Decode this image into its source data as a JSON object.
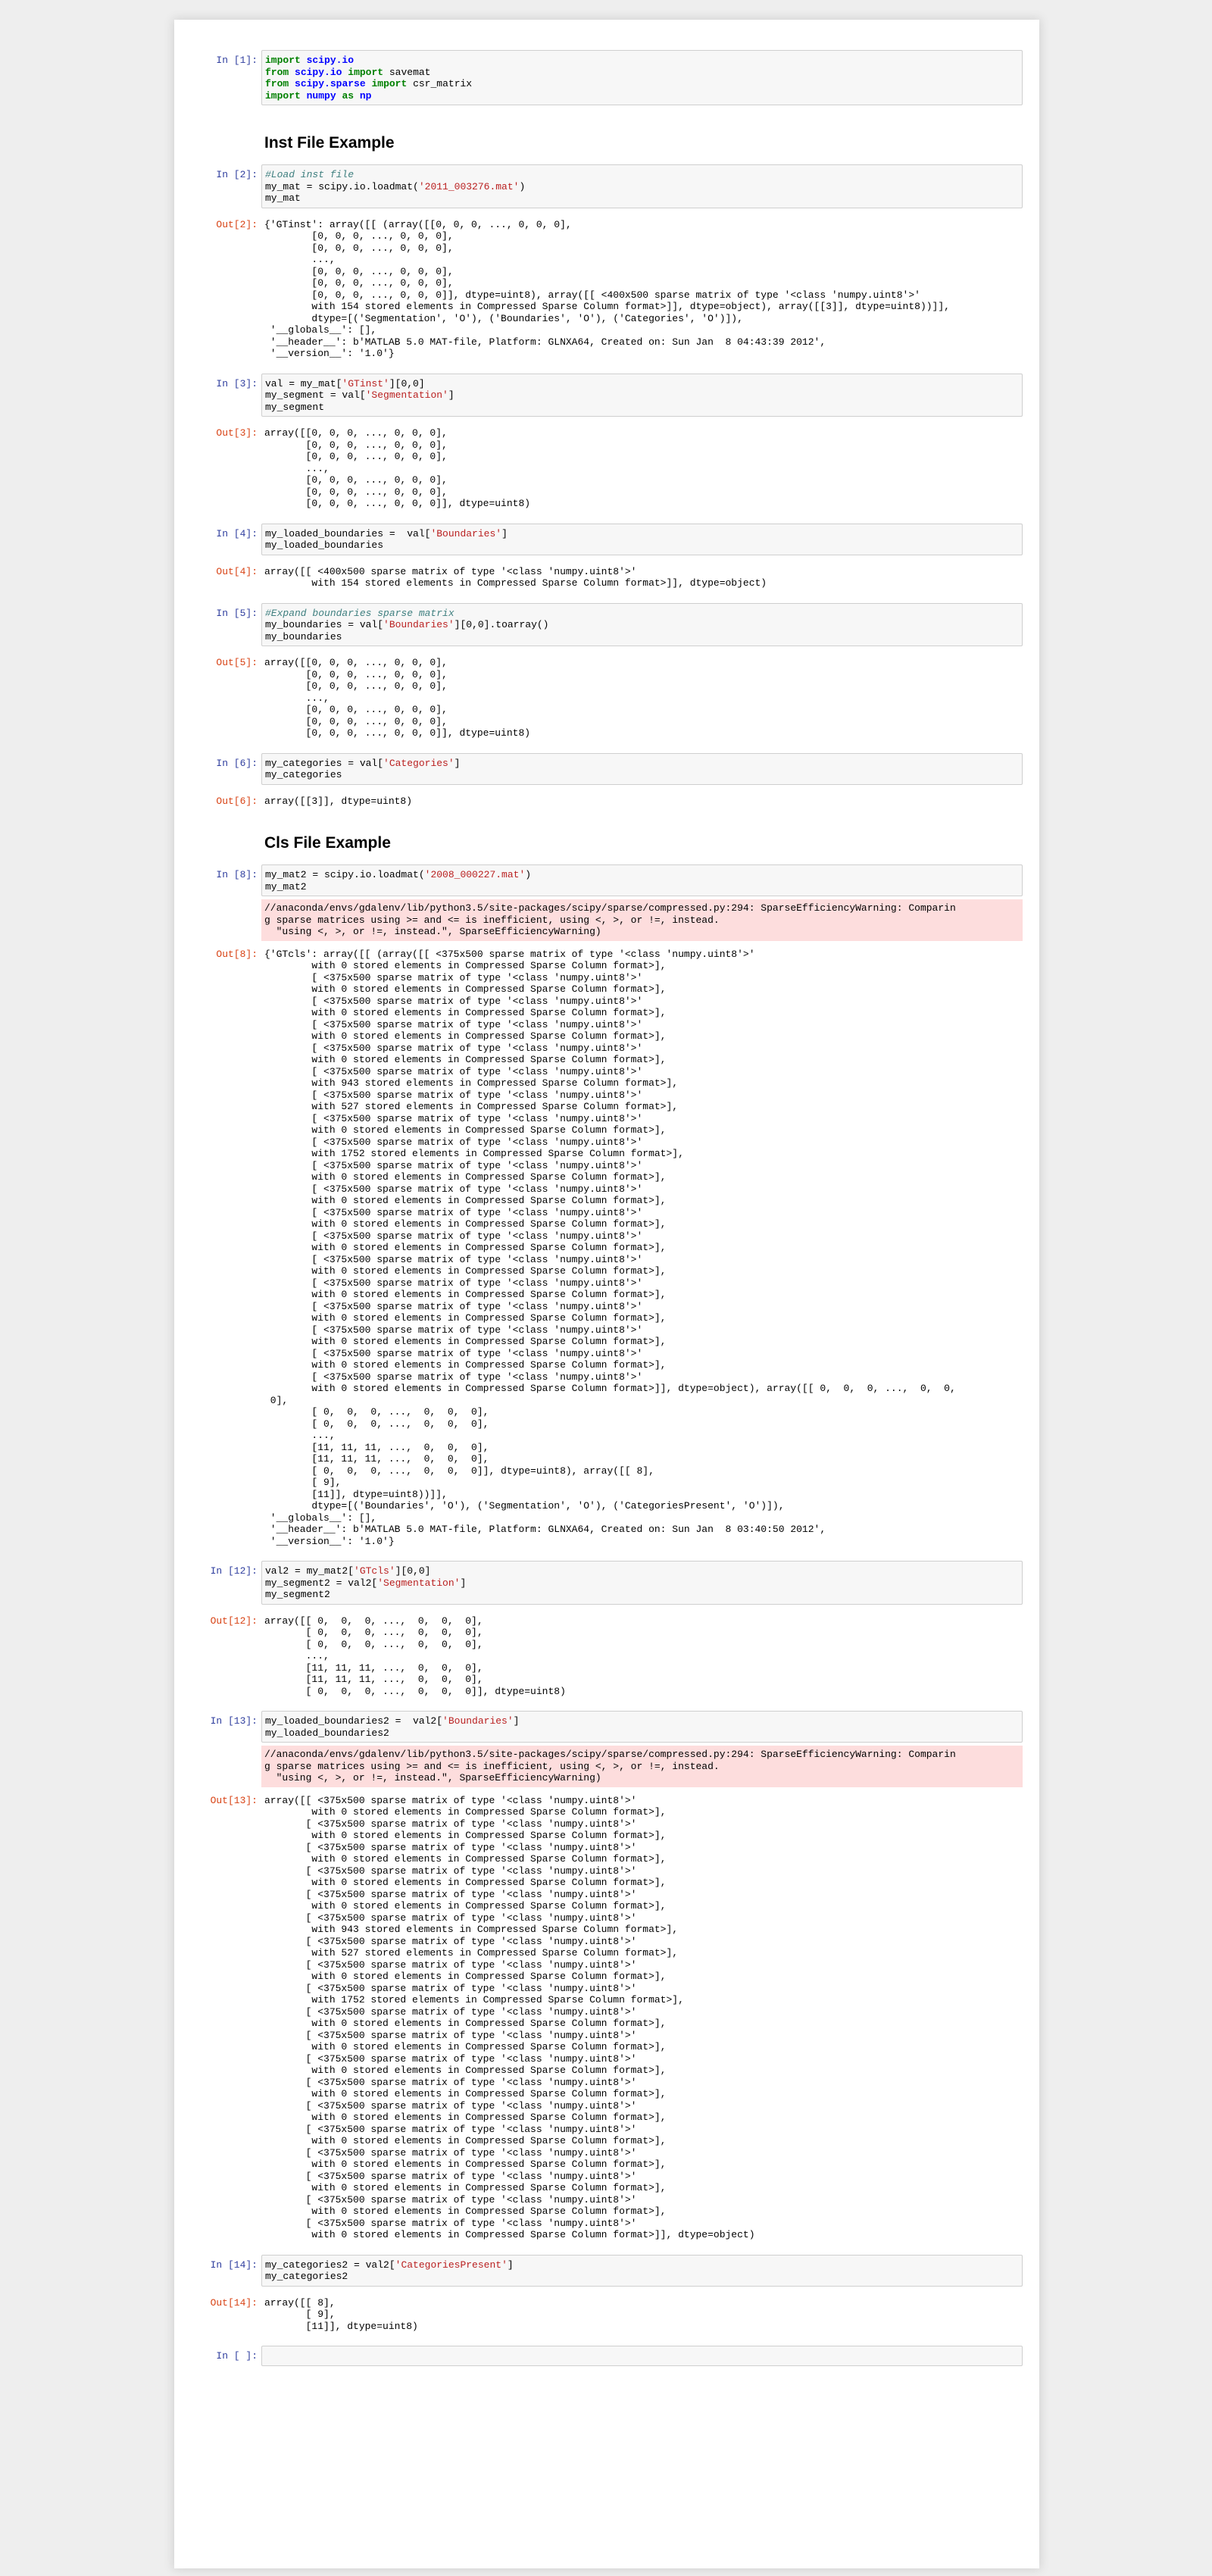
{
  "cells": [
    {
      "type": "code",
      "prompt": "In [1]:",
      "lines": [
        [
          [
            "import",
            "kw"
          ],
          [
            " "
          ],
          [
            "scipy.io",
            "mod"
          ]
        ],
        [
          [
            "from",
            "kw"
          ],
          [
            " "
          ],
          [
            "scipy.io",
            "mod"
          ],
          [
            " "
          ],
          [
            "import",
            "kw"
          ],
          [
            " savemat"
          ]
        ],
        [
          [
            "from",
            "kw"
          ],
          [
            " "
          ],
          [
            "scipy.sparse",
            "mod"
          ],
          [
            " "
          ],
          [
            "import",
            "kw"
          ],
          [
            " csr_matrix"
          ]
        ],
        [
          [
            "import",
            "kw"
          ],
          [
            " "
          ],
          [
            "numpy",
            "mod"
          ],
          [
            " "
          ],
          [
            "as",
            "kw"
          ],
          [
            " "
          ],
          [
            "np",
            "mod"
          ]
        ]
      ]
    },
    {
      "type": "heading",
      "text": "Inst File Example"
    },
    {
      "type": "code",
      "prompt": "In [2]:",
      "lines": [
        [
          [
            "#Load inst file",
            "cmt"
          ]
        ],
        [
          [
            "my_mat = scipy.io.loadmat("
          ],
          [
            "'2011_003276.mat'",
            "str"
          ],
          [
            ")"
          ]
        ],
        [
          [
            "my_mat"
          ]
        ]
      ],
      "out_prompt": "Out[2]:",
      "output": "{'GTinst': array([[ (array([[0, 0, 0, ..., 0, 0, 0],\n        [0, 0, 0, ..., 0, 0, 0],\n        [0, 0, 0, ..., 0, 0, 0],\n        ...,\n        [0, 0, 0, ..., 0, 0, 0],\n        [0, 0, 0, ..., 0, 0, 0],\n        [0, 0, 0, ..., 0, 0, 0]], dtype=uint8), array([[ <400x500 sparse matrix of type '<class 'numpy.uint8'>'\n        with 154 stored elements in Compressed Sparse Column format>]], dtype=object), array([[3]], dtype=uint8))]],\n        dtype=[('Segmentation', 'O'), ('Boundaries', 'O'), ('Categories', 'O')]),\n '__globals__': [],\n '__header__': b'MATLAB 5.0 MAT-file, Platform: GLNXA64, Created on: Sun Jan  8 04:43:39 2012',\n '__version__': '1.0'}"
    },
    {
      "type": "code",
      "prompt": "In [3]:",
      "lines": [
        [
          [
            "val = my_mat["
          ],
          [
            "'GTinst'",
            "str"
          ],
          [
            "][0,0]"
          ]
        ],
        [
          [
            "my_segment = val["
          ],
          [
            "'Segmentation'",
            "str"
          ],
          [
            "]"
          ]
        ],
        [
          [
            "my_segment"
          ]
        ]
      ],
      "out_prompt": "Out[3]:",
      "output": "array([[0, 0, 0, ..., 0, 0, 0],\n       [0, 0, 0, ..., 0, 0, 0],\n       [0, 0, 0, ..., 0, 0, 0],\n       ...,\n       [0, 0, 0, ..., 0, 0, 0],\n       [0, 0, 0, ..., 0, 0, 0],\n       [0, 0, 0, ..., 0, 0, 0]], dtype=uint8)"
    },
    {
      "type": "code",
      "prompt": "In [4]:",
      "lines": [
        [
          [
            "my_loaded_boundaries =  val["
          ],
          [
            "'Boundaries'",
            "str"
          ],
          [
            "]"
          ]
        ],
        [
          [
            "my_loaded_boundaries"
          ]
        ]
      ],
      "out_prompt": "Out[4]:",
      "output": "array([[ <400x500 sparse matrix of type '<class 'numpy.uint8'>'\n        with 154 stored elements in Compressed Sparse Column format>]], dtype=object)"
    },
    {
      "type": "code",
      "prompt": "In [5]:",
      "lines": [
        [
          [
            "#Expand boundaries sparse matrix",
            "cmt"
          ]
        ],
        [
          [
            "my_boundaries = val["
          ],
          [
            "'Boundaries'",
            "str"
          ],
          [
            "][0,0].toarray()"
          ]
        ],
        [
          [
            "my_boundaries"
          ]
        ]
      ],
      "out_prompt": "Out[5]:",
      "output": "array([[0, 0, 0, ..., 0, 0, 0],\n       [0, 0, 0, ..., 0, 0, 0],\n       [0, 0, 0, ..., 0, 0, 0],\n       ...,\n       [0, 0, 0, ..., 0, 0, 0],\n       [0, 0, 0, ..., 0, 0, 0],\n       [0, 0, 0, ..., 0, 0, 0]], dtype=uint8)"
    },
    {
      "type": "code",
      "prompt": "In [6]:",
      "lines": [
        [
          [
            "my_categories = val["
          ],
          [
            "'Categories'",
            "str"
          ],
          [
            "]"
          ]
        ],
        [
          [
            "my_categories"
          ]
        ]
      ],
      "out_prompt": "Out[6]:",
      "output": "array([[3]], dtype=uint8)"
    },
    {
      "type": "heading",
      "text": "Cls File Example"
    },
    {
      "type": "code",
      "prompt": "In [8]:",
      "lines": [
        [
          [
            "my_mat2 = scipy.io.loadmat("
          ],
          [
            "'2008_000227.mat'",
            "str"
          ],
          [
            ")"
          ]
        ],
        [
          [
            "my_mat2"
          ]
        ]
      ],
      "stderr": "//anaconda/envs/gdalenv/lib/python3.5/site-packages/scipy/sparse/compressed.py:294: SparseEfficiencyWarning: Comparin\ng sparse matrices using >= and <= is inefficient, using <, >, or !=, instead.\n  \"using <, >, or !=, instead.\", SparseEfficiencyWarning)",
      "out_prompt": "Out[8]:",
      "output": "{'GTcls': array([[ (array([[ <375x500 sparse matrix of type '<class 'numpy.uint8'>'\n        with 0 stored elements in Compressed Sparse Column format>],\n        [ <375x500 sparse matrix of type '<class 'numpy.uint8'>'\n        with 0 stored elements in Compressed Sparse Column format>],\n        [ <375x500 sparse matrix of type '<class 'numpy.uint8'>'\n        with 0 stored elements in Compressed Sparse Column format>],\n        [ <375x500 sparse matrix of type '<class 'numpy.uint8'>'\n        with 0 stored elements in Compressed Sparse Column format>],\n        [ <375x500 sparse matrix of type '<class 'numpy.uint8'>'\n        with 0 stored elements in Compressed Sparse Column format>],\n        [ <375x500 sparse matrix of type '<class 'numpy.uint8'>'\n        with 943 stored elements in Compressed Sparse Column format>],\n        [ <375x500 sparse matrix of type '<class 'numpy.uint8'>'\n        with 527 stored elements in Compressed Sparse Column format>],\n        [ <375x500 sparse matrix of type '<class 'numpy.uint8'>'\n        with 0 stored elements in Compressed Sparse Column format>],\n        [ <375x500 sparse matrix of type '<class 'numpy.uint8'>'\n        with 1752 stored elements in Compressed Sparse Column format>],\n        [ <375x500 sparse matrix of type '<class 'numpy.uint8'>'\n        with 0 stored elements in Compressed Sparse Column format>],\n        [ <375x500 sparse matrix of type '<class 'numpy.uint8'>'\n        with 0 stored elements in Compressed Sparse Column format>],\n        [ <375x500 sparse matrix of type '<class 'numpy.uint8'>'\n        with 0 stored elements in Compressed Sparse Column format>],\n        [ <375x500 sparse matrix of type '<class 'numpy.uint8'>'\n        with 0 stored elements in Compressed Sparse Column format>],\n        [ <375x500 sparse matrix of type '<class 'numpy.uint8'>'\n        with 0 stored elements in Compressed Sparse Column format>],\n        [ <375x500 sparse matrix of type '<class 'numpy.uint8'>'\n        with 0 stored elements in Compressed Sparse Column format>],\n        [ <375x500 sparse matrix of type '<class 'numpy.uint8'>'\n        with 0 stored elements in Compressed Sparse Column format>],\n        [ <375x500 sparse matrix of type '<class 'numpy.uint8'>'\n        with 0 stored elements in Compressed Sparse Column format>],\n        [ <375x500 sparse matrix of type '<class 'numpy.uint8'>'\n        with 0 stored elements in Compressed Sparse Column format>],\n        [ <375x500 sparse matrix of type '<class 'numpy.uint8'>'\n        with 0 stored elements in Compressed Sparse Column format>]], dtype=object), array([[ 0,  0,  0, ...,  0,  0,\n 0],\n        [ 0,  0,  0, ...,  0,  0,  0],\n        [ 0,  0,  0, ...,  0,  0,  0],\n        ...,\n        [11, 11, 11, ...,  0,  0,  0],\n        [11, 11, 11, ...,  0,  0,  0],\n        [ 0,  0,  0, ...,  0,  0,  0]], dtype=uint8), array([[ 8],\n        [ 9],\n        [11]], dtype=uint8))]],\n        dtype=[('Boundaries', 'O'), ('Segmentation', 'O'), ('CategoriesPresent', 'O')]),\n '__globals__': [],\n '__header__': b'MATLAB 5.0 MAT-file, Platform: GLNXA64, Created on: Sun Jan  8 03:40:50 2012',\n '__version__': '1.0'}"
    },
    {
      "type": "code",
      "prompt": "In [12]:",
      "lines": [
        [
          [
            "val2 = my_mat2["
          ],
          [
            "'GTcls'",
            "str"
          ],
          [
            "][0,0]"
          ]
        ],
        [
          [
            "my_segment2 = val2["
          ],
          [
            "'Segmentation'",
            "str"
          ],
          [
            "]"
          ]
        ],
        [
          [
            "my_segment2"
          ]
        ]
      ],
      "out_prompt": "Out[12]:",
      "output": "array([[ 0,  0,  0, ...,  0,  0,  0],\n       [ 0,  0,  0, ...,  0,  0,  0],\n       [ 0,  0,  0, ...,  0,  0,  0],\n       ...,\n       [11, 11, 11, ...,  0,  0,  0],\n       [11, 11, 11, ...,  0,  0,  0],\n       [ 0,  0,  0, ...,  0,  0,  0]], dtype=uint8)"
    },
    {
      "type": "code",
      "prompt": "In [13]:",
      "lines": [
        [
          [
            "my_loaded_boundaries2 =  val2["
          ],
          [
            "'Boundaries'",
            "str"
          ],
          [
            "]"
          ]
        ],
        [
          [
            "my_loaded_boundaries2"
          ]
        ]
      ],
      "stderr": "//anaconda/envs/gdalenv/lib/python3.5/site-packages/scipy/sparse/compressed.py:294: SparseEfficiencyWarning: Comparin\ng sparse matrices using >= and <= is inefficient, using <, >, or !=, instead.\n  \"using <, >, or !=, instead.\", SparseEfficiencyWarning)",
      "out_prompt": "Out[13]:",
      "output": "array([[ <375x500 sparse matrix of type '<class 'numpy.uint8'>'\n        with 0 stored elements in Compressed Sparse Column format>],\n       [ <375x500 sparse matrix of type '<class 'numpy.uint8'>'\n        with 0 stored elements in Compressed Sparse Column format>],\n       [ <375x500 sparse matrix of type '<class 'numpy.uint8'>'\n        with 0 stored elements in Compressed Sparse Column format>],\n       [ <375x500 sparse matrix of type '<class 'numpy.uint8'>'\n        with 0 stored elements in Compressed Sparse Column format>],\n       [ <375x500 sparse matrix of type '<class 'numpy.uint8'>'\n        with 0 stored elements in Compressed Sparse Column format>],\n       [ <375x500 sparse matrix of type '<class 'numpy.uint8'>'\n        with 943 stored elements in Compressed Sparse Column format>],\n       [ <375x500 sparse matrix of type '<class 'numpy.uint8'>'\n        with 527 stored elements in Compressed Sparse Column format>],\n       [ <375x500 sparse matrix of type '<class 'numpy.uint8'>'\n        with 0 stored elements in Compressed Sparse Column format>],\n       [ <375x500 sparse matrix of type '<class 'numpy.uint8'>'\n        with 1752 stored elements in Compressed Sparse Column format>],\n       [ <375x500 sparse matrix of type '<class 'numpy.uint8'>'\n        with 0 stored elements in Compressed Sparse Column format>],\n       [ <375x500 sparse matrix of type '<class 'numpy.uint8'>'\n        with 0 stored elements in Compressed Sparse Column format>],\n       [ <375x500 sparse matrix of type '<class 'numpy.uint8'>'\n        with 0 stored elements in Compressed Sparse Column format>],\n       [ <375x500 sparse matrix of type '<class 'numpy.uint8'>'\n        with 0 stored elements in Compressed Sparse Column format>],\n       [ <375x500 sparse matrix of type '<class 'numpy.uint8'>'\n        with 0 stored elements in Compressed Sparse Column format>],\n       [ <375x500 sparse matrix of type '<class 'numpy.uint8'>'\n        with 0 stored elements in Compressed Sparse Column format>],\n       [ <375x500 sparse matrix of type '<class 'numpy.uint8'>'\n        with 0 stored elements in Compressed Sparse Column format>],\n       [ <375x500 sparse matrix of type '<class 'numpy.uint8'>'\n        with 0 stored elements in Compressed Sparse Column format>],\n       [ <375x500 sparse matrix of type '<class 'numpy.uint8'>'\n        with 0 stored elements in Compressed Sparse Column format>],\n       [ <375x500 sparse matrix of type '<class 'numpy.uint8'>'\n        with 0 stored elements in Compressed Sparse Column format>]], dtype=object)"
    },
    {
      "type": "code",
      "prompt": "In [14]:",
      "lines": [
        [
          [
            "my_categories2 = val2["
          ],
          [
            "'CategoriesPresent'",
            "str"
          ],
          [
            "]"
          ]
        ],
        [
          [
            "my_categories2"
          ]
        ]
      ],
      "out_prompt": "Out[14]:",
      "output": "array([[ 8],\n       [ 9],\n       [11]], dtype=uint8)"
    },
    {
      "type": "code",
      "prompt": "In [ ]:",
      "lines": [
        [
          [
            ""
          ]
        ]
      ]
    }
  ]
}
